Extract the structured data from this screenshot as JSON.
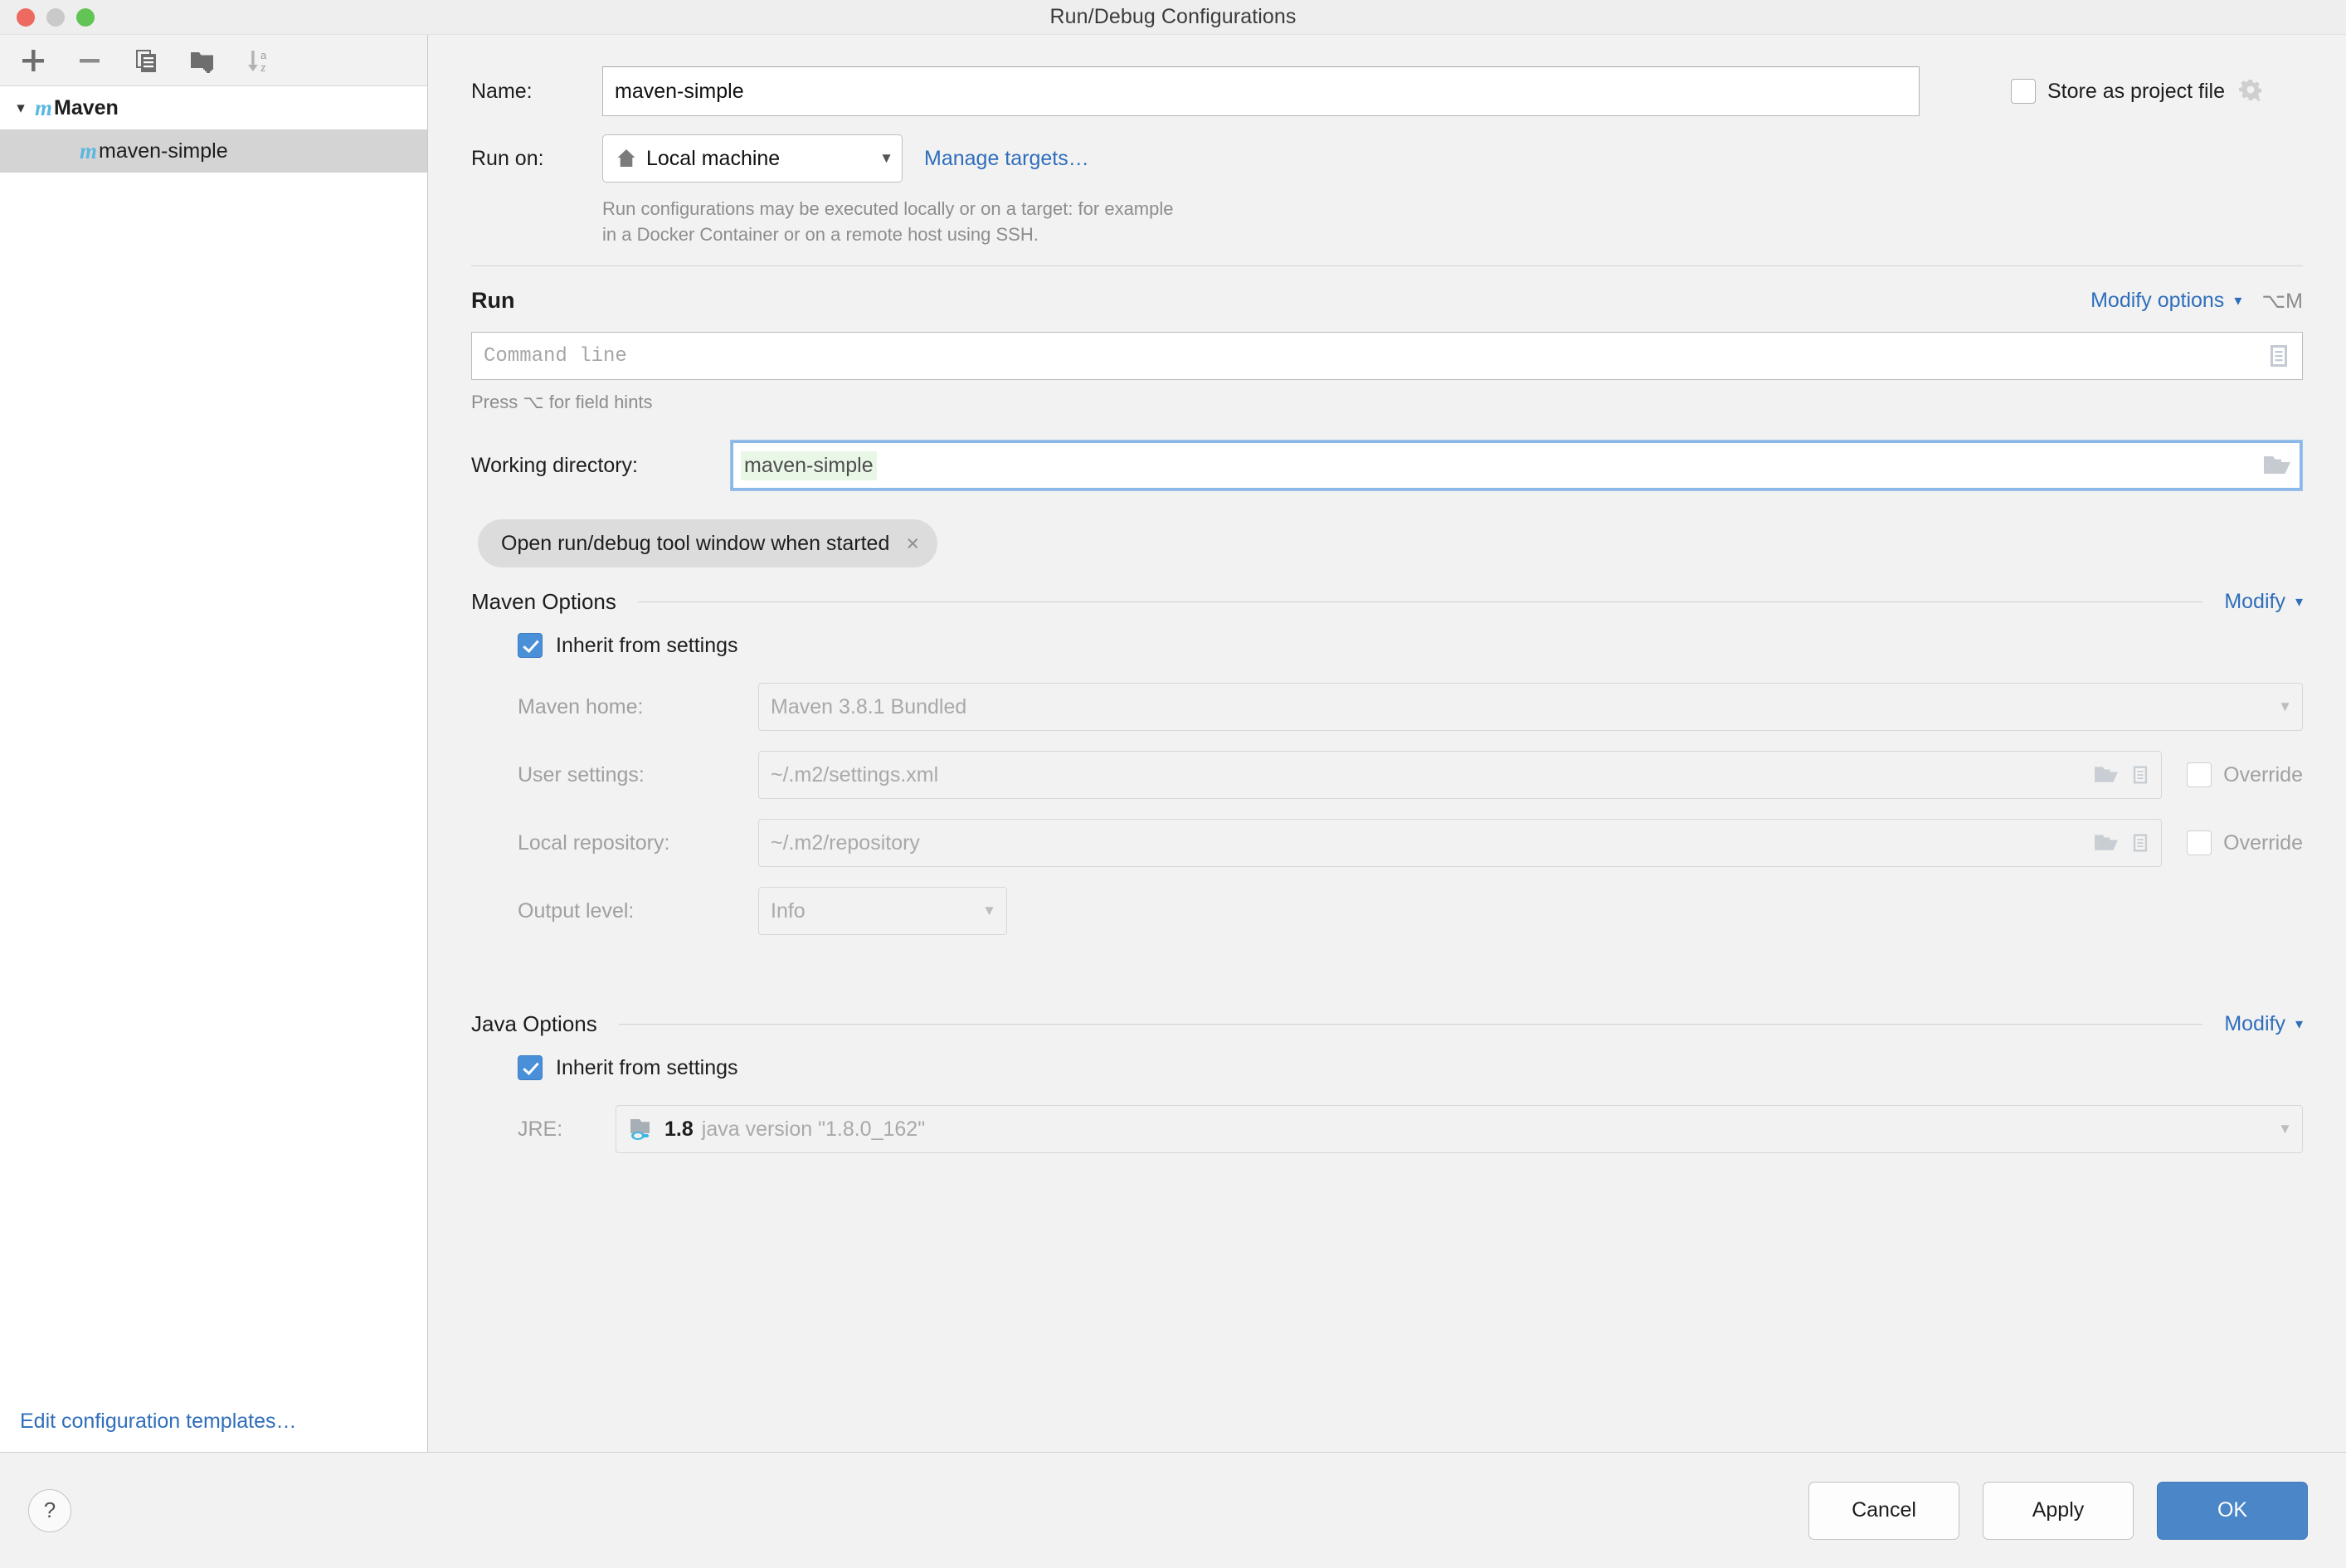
{
  "window": {
    "title": "Run/Debug Configurations",
    "traffic_lights": [
      "close",
      "minimize",
      "zoom"
    ]
  },
  "left_panel": {
    "toolbar": [
      {
        "name": "add-configuration-button",
        "icon": "plus-icon"
      },
      {
        "name": "remove-configuration-button",
        "icon": "minus-icon"
      },
      {
        "name": "copy-configuration-button",
        "icon": "copy-icon"
      },
      {
        "name": "new-folder-button",
        "icon": "new-folder-icon"
      },
      {
        "name": "sort-configurations-button",
        "icon": "sort-az-icon"
      }
    ],
    "tree": [
      {
        "label": "Maven",
        "icon": "maven-icon",
        "expanded": true,
        "selected": false,
        "level": 0
      },
      {
        "label": "maven-simple",
        "icon": "maven-icon",
        "expanded": false,
        "selected": true,
        "level": 1
      }
    ],
    "edit_templates_link": "Edit configuration templates…"
  },
  "form": {
    "name_label": "Name:",
    "name_value": "maven-simple",
    "name_placeholder": "",
    "store_as_project_file": {
      "label": "Store as project file",
      "checked": false,
      "gear_icon": "gear-icon"
    },
    "run_on_label": "Run on:",
    "run_on_value": "Local machine",
    "run_on_icon": "home-icon",
    "manage_targets_link": "Manage targets…",
    "run_on_hint_line1": "Run configurations may be executed locally or on a target: for example",
    "run_on_hint_line2": "in a Docker Container or on a remote host using SSH.",
    "run_section": {
      "title": "Run",
      "modify_options_label": "Modify options",
      "modify_options_shortcut": "⌥M",
      "command_line_placeholder": "Command line",
      "command_line_value": "",
      "expand_icon": "expand-editor-icon",
      "press_hint": "Press ⌥ for field hints"
    },
    "working_directory": {
      "label": "Working directory:",
      "value": "maven-simple",
      "folder_icon": "folder-icon",
      "focused": true
    },
    "chips": [
      {
        "label": "Open run/debug tool window when started",
        "close_icon": "close-icon"
      }
    ],
    "maven_options": {
      "title": "Maven Options",
      "modify_label": "Modify",
      "inherit": {
        "label": "Inherit from settings",
        "checked": true
      },
      "fields": [
        {
          "name": "maven-home",
          "label": "Maven home:",
          "value": "Maven 3.8.1 Bundled",
          "kind": "combo",
          "disabled": true
        },
        {
          "name": "user-settings",
          "label": "User settings:",
          "value": "~/.m2/settings.xml",
          "kind": "path",
          "disabled": true,
          "override": {
            "label": "Override",
            "checked": false
          }
        },
        {
          "name": "local-repository",
          "label": "Local repository:",
          "value": "~/.m2/repository",
          "kind": "path",
          "disabled": true,
          "override": {
            "label": "Override",
            "checked": false
          }
        },
        {
          "name": "output-level",
          "label": "Output level:",
          "value": "Info",
          "kind": "combo-small",
          "disabled": true
        }
      ]
    },
    "java_options": {
      "title": "Java Options",
      "modify_label": "Modify",
      "inherit": {
        "label": "Inherit from settings",
        "checked": true
      },
      "jre": {
        "label": "JRE:",
        "version": "1.8",
        "description": "java version \"1.8.0_162\"",
        "icon": "jdk-icon",
        "disabled": true
      }
    }
  },
  "bottom_bar": {
    "help_label": "?",
    "buttons": [
      {
        "name": "cancel-button",
        "label": "Cancel",
        "primary": false
      },
      {
        "name": "apply-button",
        "label": "Apply",
        "primary": false
      },
      {
        "name": "ok-button",
        "label": "OK",
        "primary": true
      }
    ]
  },
  "colors": {
    "accent_blue": "#4a86c8",
    "link_blue": "#2f6ebb",
    "maven_icon_blue": "#5bb8e0",
    "selection_gray": "#d4d4d4",
    "panel_bg": "#f2f2f2",
    "focus_border": "#8bb8e8",
    "macro_highlight": "#e9f7e7"
  }
}
